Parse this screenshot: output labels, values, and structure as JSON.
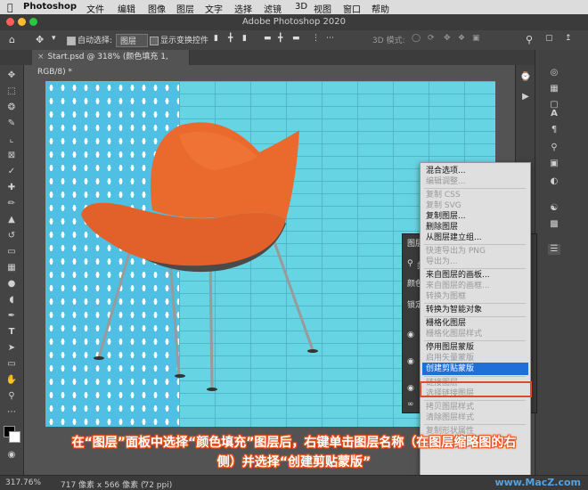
{
  "menubar": {
    "app": "Photoshop",
    "items": [
      "文件",
      "编辑",
      "图像",
      "图层",
      "文字",
      "选择",
      "滤镜",
      "3D",
      "视图",
      "窗口",
      "帮助"
    ]
  },
  "window": {
    "title": "Adobe Photoshop 2020"
  },
  "options": {
    "auto_select_label": "自动选择:",
    "auto_select_value": "图层",
    "show_transform_label": "显示变换控件",
    "mode3d_label": "3D 模式:"
  },
  "document": {
    "tab_title": "Start.psd @ 318% (颜色填充 1, RGB/8) *"
  },
  "layers_panel": {
    "title": "图层",
    "filter_label": "类",
    "blend_label": "颜色",
    "lock_label": "锁定:"
  },
  "context_menu": {
    "items": [
      {
        "label": "混合选项...",
        "enabled": true
      },
      {
        "label": "编辑调整...",
        "enabled": false
      },
      {
        "sep": true
      },
      {
        "label": "复制 CSS",
        "enabled": false
      },
      {
        "label": "复制 SVG",
        "enabled": false
      },
      {
        "label": "复制图层...",
        "enabled": true
      },
      {
        "label": "删除图层",
        "enabled": true
      },
      {
        "label": "从图层建立组...",
        "enabled": true
      },
      {
        "sep": true
      },
      {
        "label": "快速导出为 PNG",
        "enabled": false
      },
      {
        "label": "导出为...",
        "enabled": false
      },
      {
        "sep": true
      },
      {
        "label": "来自图层的画板...",
        "enabled": true
      },
      {
        "label": "来自图层的画框...",
        "enabled": false
      },
      {
        "label": "转换为图框",
        "enabled": false
      },
      {
        "sep": true
      },
      {
        "label": "转换为智能对象",
        "enabled": true
      },
      {
        "sep": true
      },
      {
        "label": "栅格化图层",
        "enabled": true
      },
      {
        "label": "栅格化图层样式",
        "enabled": false
      },
      {
        "sep": true
      },
      {
        "label": "停用图层蒙版",
        "enabled": true
      },
      {
        "label": "启用矢量蒙版",
        "enabled": false
      },
      {
        "label": "创建剪贴蒙版",
        "enabled": true,
        "highlighted": true
      },
      {
        "sep": true
      },
      {
        "label": "链接图层",
        "enabled": false
      },
      {
        "label": "选择链接图层",
        "enabled": false
      },
      {
        "sep": true
      },
      {
        "label": "拷贝图层样式",
        "enabled": false
      },
      {
        "label": "清除图层样式",
        "enabled": false
      },
      {
        "sep": true
      },
      {
        "label": "复制形状属性",
        "enabled": false
      }
    ]
  },
  "caption": {
    "line1": "在“图层”面板中选择“颜色填充”图层后，右键单击图层名称（在图层缩略图的右",
    "line2": "侧）并选择“创建剪贴蒙版”"
  },
  "status": {
    "zoom": "317.76%",
    "size": "717 像素 x 566 像素 (72 ppi)",
    "watermark": "www.MacZ.com"
  },
  "colors": {
    "highlight": "#1f6fd8",
    "annotation_box": "#e04a2a",
    "caption_outline": "#e8531f"
  }
}
